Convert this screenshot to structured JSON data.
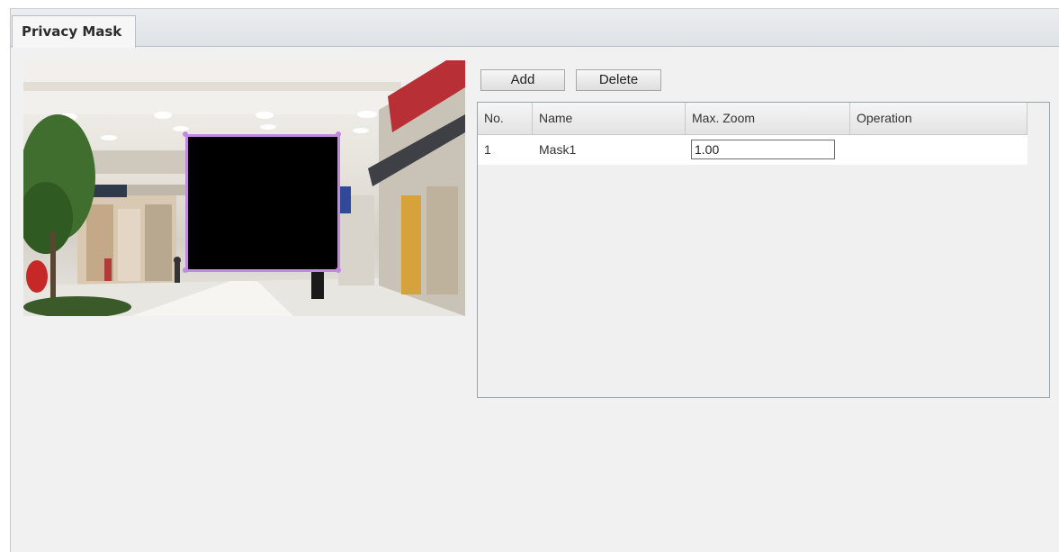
{
  "tabs": [
    {
      "label": "Privacy Mask",
      "active": true
    }
  ],
  "preview": {
    "scene": "mall-camera-view",
    "mask_color": "#000000",
    "mask_border_color": "#c08adf"
  },
  "toolbar": {
    "add_label": "Add",
    "delete_label": "Delete"
  },
  "table": {
    "columns": [
      "No.",
      "Name",
      "Max. Zoom",
      "Operation"
    ],
    "rows": [
      {
        "no": "1",
        "name": "Mask1",
        "max_zoom": "1.00",
        "operation": ""
      }
    ]
  }
}
